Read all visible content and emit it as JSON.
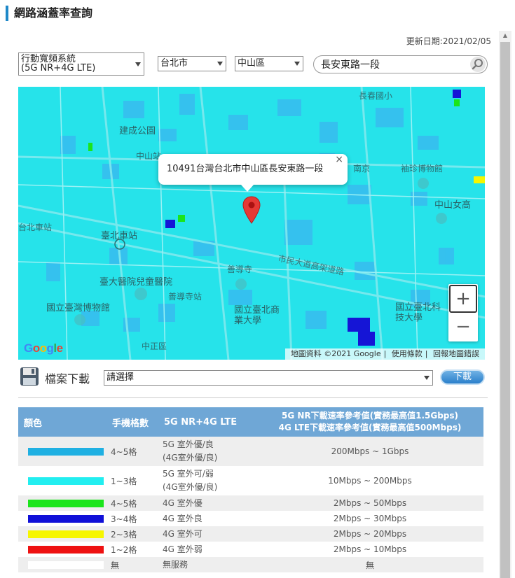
{
  "page": {
    "title": "網路涵蓋率查詢",
    "update_date": "更新日期:2021/02/05"
  },
  "filters": {
    "system": {
      "line1": "行動寬頻系統",
      "line2": "(5G NR+4G LTE)"
    },
    "city": "台北市",
    "district": "中山區",
    "search_value": "長安東路一段"
  },
  "map": {
    "popup_text": "10491台灣台北市中山區長安東路一段",
    "close": "×",
    "zoom_in": "+",
    "zoom_out": "−",
    "logo": "Google",
    "footer": {
      "data": "地圖資料 ©2021 Google",
      "terms": "使用條款",
      "report": "回報地圖錯誤"
    },
    "labels": {
      "changchun": "長春國小",
      "chengde": "建成公園",
      "zhongshan_station": "中山站",
      "south_jing": "南京",
      "xiuzhen": "袖珍博物館",
      "zhongshan_girls": "中山女高",
      "taipei_station": "台北車站",
      "taipei_main": "臺北車站",
      "shandao": "善導寺",
      "civic_expressway": "市民大道高架道路",
      "children_hospital": "臺大醫院兒童醫院",
      "taiwan_museum": "國立臺灣博物館",
      "ntub": "國立臺北商業大學",
      "ntut": "國立臺北科技大學",
      "zhongzheng": "中正區",
      "shandao_station": "善導寺站"
    }
  },
  "download": {
    "label": "檔案下載",
    "select_placeholder": "請選擇",
    "button": "下載"
  },
  "legend": {
    "headers": {
      "color": "顏色",
      "bars": "手機格數",
      "type": "5G NR+4G LTE",
      "speed_line1": "5G NR下載速率參考值(實務最高值1.5Gbps)",
      "speed_line2": "4G LTE下載速率參考值(實務最高值500Mbps)"
    },
    "rows": [
      {
        "color": "#1fb0e2",
        "bars": "4~5格",
        "type1": "5G 室外優/良",
        "type2": "(4G室外優/良)",
        "speed": "200Mbps ~ 1Gbps"
      },
      {
        "color": "#22eef0",
        "bars": "1~3格",
        "type1": "5G 室外可/弱",
        "type2": "(4G室外優/良)",
        "speed": "10Mbps ~ 200Mbps"
      },
      {
        "color": "#1be51b",
        "bars": "4~5格",
        "type1": "4G 室外優",
        "type2": "",
        "speed": "2Mbps ~ 50Mbps"
      },
      {
        "color": "#1010d8",
        "bars": "3~4格",
        "type1": "4G 室外良",
        "type2": "",
        "speed": "2Mbps ~ 30Mbps"
      },
      {
        "color": "#f6f600",
        "bars": "2~3格",
        "type1": "4G 室外可",
        "type2": "",
        "speed": "2Mbps ~ 20Mbps"
      },
      {
        "color": "#ee1111",
        "bars": "1~2格",
        "type1": "4G 室外弱",
        "type2": "",
        "speed": "2Mbps ~ 10Mbps"
      },
      {
        "color": "#ffffff",
        "bars": "無",
        "type1": "無服務",
        "type2": "",
        "speed": "無"
      }
    ]
  }
}
